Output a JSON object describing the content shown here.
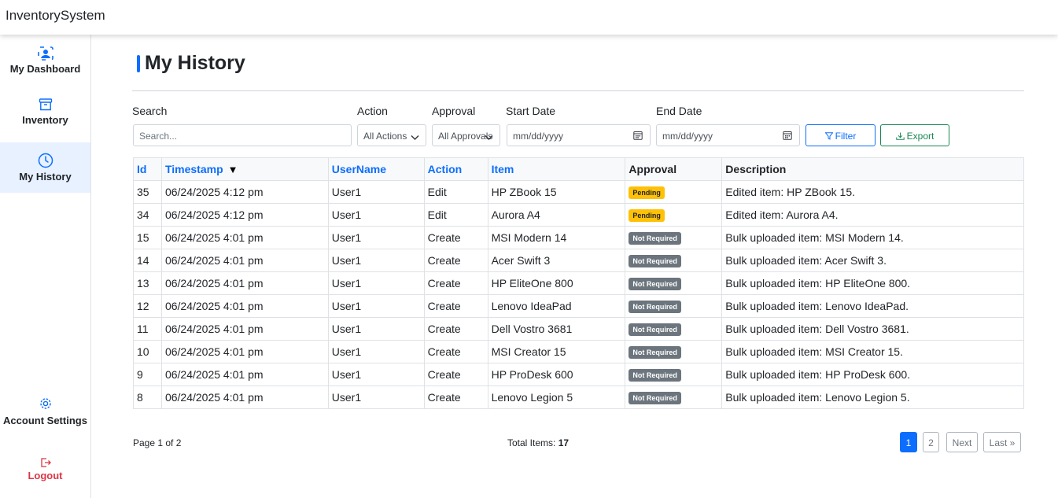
{
  "app": {
    "title": "InventorySystem"
  },
  "sidebar": {
    "items": [
      {
        "label": "My Dashboard",
        "icon": "person-badge-icon"
      },
      {
        "label": "Inventory",
        "icon": "archive-icon"
      },
      {
        "label": "My History",
        "icon": "clock-icon",
        "active": true
      }
    ],
    "account": "Account Settings",
    "logout": "Logout"
  },
  "page": {
    "title": "My History"
  },
  "filters": {
    "search_label": "Search",
    "search_placeholder": "Search...",
    "action_label": "Action",
    "action_value": "All Actions",
    "approval_label": "Approval",
    "approval_value": "All Approvals",
    "start_label": "Start Date",
    "start_placeholder": "mm/dd/yyyy",
    "end_label": "End Date",
    "end_placeholder": "mm/dd/yyyy",
    "filter_button": "Filter",
    "export_button": "Export"
  },
  "table": {
    "headers": [
      "Id",
      "Timestamp",
      "UserName",
      "Action",
      "Item",
      "Approval",
      "Description"
    ],
    "rows": [
      {
        "id": "35",
        "timestamp": "06/24/2025 4:12 pm",
        "user": "User1",
        "action": "Edit",
        "item": "HP ZBook 15",
        "approval": "Pending",
        "description": "Edited item: HP ZBook 15."
      },
      {
        "id": "34",
        "timestamp": "06/24/2025 4:12 pm",
        "user": "User1",
        "action": "Edit",
        "item": "Aurora A4",
        "approval": "Pending",
        "description": "Edited item: Aurora A4."
      },
      {
        "id": "15",
        "timestamp": "06/24/2025 4:01 pm",
        "user": "User1",
        "action": "Create",
        "item": "MSI Modern 14",
        "approval": "Not Required",
        "description": "Bulk uploaded item: MSI Modern 14."
      },
      {
        "id": "14",
        "timestamp": "06/24/2025 4:01 pm",
        "user": "User1",
        "action": "Create",
        "item": "Acer Swift 3",
        "approval": "Not Required",
        "description": "Bulk uploaded item: Acer Swift 3."
      },
      {
        "id": "13",
        "timestamp": "06/24/2025 4:01 pm",
        "user": "User1",
        "action": "Create",
        "item": "HP EliteOne 800",
        "approval": "Not Required",
        "description": "Bulk uploaded item: HP EliteOne 800."
      },
      {
        "id": "12",
        "timestamp": "06/24/2025 4:01 pm",
        "user": "User1",
        "action": "Create",
        "item": "Lenovo IdeaPad",
        "approval": "Not Required",
        "description": "Bulk uploaded item: Lenovo IdeaPad."
      },
      {
        "id": "11",
        "timestamp": "06/24/2025 4:01 pm",
        "user": "User1",
        "action": "Create",
        "item": "Dell Vostro 3681",
        "approval": "Not Required",
        "description": "Bulk uploaded item: Dell Vostro 3681."
      },
      {
        "id": "10",
        "timestamp": "06/24/2025 4:01 pm",
        "user": "User1",
        "action": "Create",
        "item": "MSI Creator 15",
        "approval": "Not Required",
        "description": "Bulk uploaded item: MSI Creator 15."
      },
      {
        "id": "9",
        "timestamp": "06/24/2025 4:01 pm",
        "user": "User1",
        "action": "Create",
        "item": "HP ProDesk 600",
        "approval": "Not Required",
        "description": "Bulk uploaded item: HP ProDesk 600."
      },
      {
        "id": "8",
        "timestamp": "06/24/2025 4:01 pm",
        "user": "User1",
        "action": "Create",
        "item": "Lenovo Legion 5",
        "approval": "Not Required",
        "description": "Bulk uploaded item: Lenovo Legion 5."
      }
    ]
  },
  "footer": {
    "page_info": "Page 1 of 2",
    "total_label": "Total Items:",
    "total_value": "17",
    "pages": [
      "1",
      "2"
    ],
    "next": "Next",
    "last": "Last »"
  },
  "colors": {
    "accent": "#0d6efd",
    "success": "#198754",
    "danger": "#dc3545",
    "pending": "#ffc107",
    "not_required": "#6c757d"
  }
}
